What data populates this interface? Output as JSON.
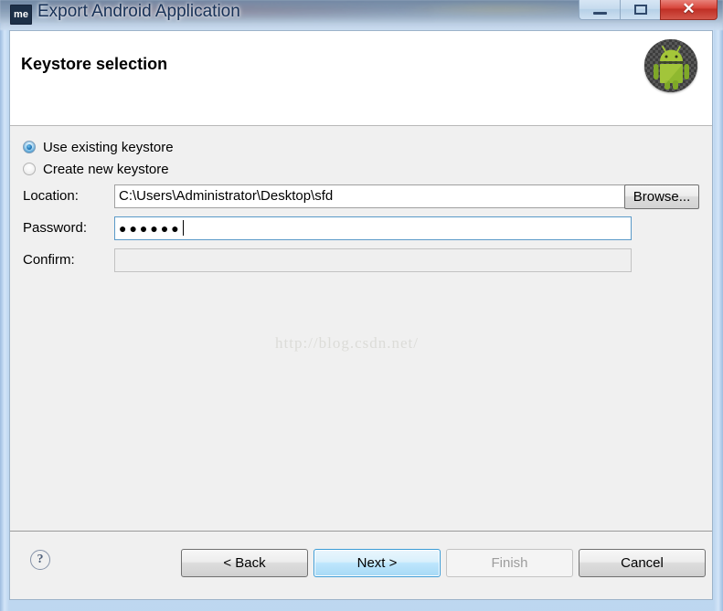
{
  "window": {
    "app_icon_text": "me",
    "title": "Export Android Application",
    "controls": {
      "minimize_label": "Minimize",
      "maximize_label": "Maximize",
      "close_label": "✕"
    }
  },
  "header": {
    "page_title": "Keystore selection",
    "badge_name": "android-robot-icon"
  },
  "form": {
    "radios": [
      {
        "label": "Use existing keystore",
        "selected": true
      },
      {
        "label": "Create new keystore",
        "selected": false
      }
    ],
    "fields": [
      {
        "label": "Location:",
        "value": "C:\\Users\\Administrator\\Desktop\\sfd",
        "placeholder": "",
        "state": "normal"
      },
      {
        "label": "Password:",
        "value": "●●●●●●",
        "placeholder": "",
        "state": "focused"
      },
      {
        "label": "Confirm:",
        "value": "",
        "placeholder": "",
        "state": "disabled"
      }
    ],
    "browse_label": "Browse..."
  },
  "watermark": {
    "text": "http://blog.csdn.net/"
  },
  "footer": {
    "help_label": "?",
    "buttons": [
      {
        "label": "< Back",
        "state": "normal"
      },
      {
        "label": "Next >",
        "state": "default"
      },
      {
        "label": "Finish",
        "state": "disabled"
      },
      {
        "label": "Cancel",
        "state": "normal"
      }
    ]
  },
  "colors": {
    "accent_blue": "#3c9cd6",
    "close_red": "#d8463b",
    "android_green": "#a4c639",
    "frame_blue": "#cfe2f6"
  }
}
